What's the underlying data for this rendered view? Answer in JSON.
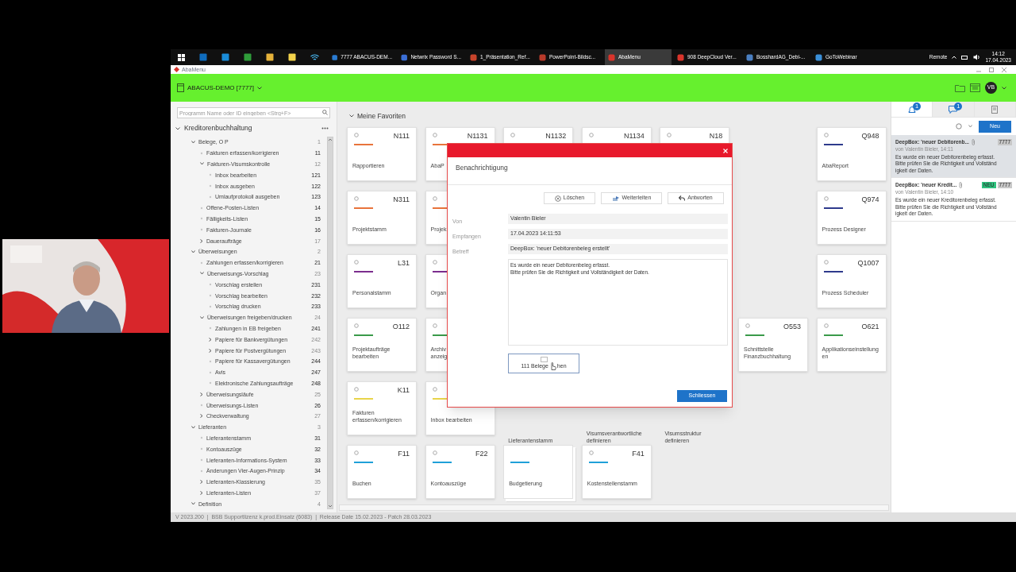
{
  "taskbar": {
    "apps": [
      {
        "label": "7777 ABACUS-DEM...",
        "color": "#2a7bd1",
        "selected": false
      },
      {
        "label": "Netwrix Password S...",
        "color": "#3b6fd6",
        "selected": false
      },
      {
        "label": "1_Präsentation_Ref...",
        "color": "#c8442b",
        "selected": false
      },
      {
        "label": "PowerPoint-Bildsc...",
        "color": "#b83a2a",
        "selected": false
      },
      {
        "label": "AbaMenu",
        "color": "#d9342b",
        "selected": true
      },
      {
        "label": "908 DeepCloud Ver...",
        "color": "#d9342b",
        "selected": false
      },
      {
        "label": "BosshardAG_Debi-...",
        "color": "#4a7fc1",
        "selected": false
      },
      {
        "label": "GoToWebinar",
        "color": "#3a8fd8",
        "selected": false
      }
    ],
    "remote": "Remote",
    "time": "14:12",
    "date": "17.04.2023"
  },
  "window": {
    "title": "AbaMenu"
  },
  "header": {
    "mandant": "ABACUS-DEMO [7777]",
    "user_initials": "VB"
  },
  "sidebar": {
    "search": {
      "placeholder": "Programm Name oder ID eingeben <Strg+F>"
    },
    "section": {
      "title": "Kreditorenbuchhaltung",
      "expanded": true
    },
    "tree": [
      {
        "label": "Belege, O P",
        "number": "1",
        "expanded": true,
        "children": [
          {
            "label": "Fakturen erfassen/korrigieren",
            "number": "11"
          },
          {
            "label": "Fakturen-Visumskontrolle",
            "number": "12",
            "expanded": true,
            "children": [
              {
                "label": "Inbox bearbeiten",
                "number": "121"
              },
              {
                "label": "Inbox ausgeben",
                "number": "122"
              },
              {
                "label": "Umlaufprotokoll ausgeben",
                "number": "123"
              }
            ]
          },
          {
            "label": "Offene-Posten-Listen",
            "number": "14"
          },
          {
            "label": "Fälligkeits-Listen",
            "number": "15"
          },
          {
            "label": "Fakturen-Journale",
            "number": "16"
          },
          {
            "label": "Daueraufträge",
            "number": "17",
            "expanded": false
          }
        ]
      },
      {
        "label": "Überweisungen",
        "number": "2",
        "expanded": true,
        "children": [
          {
            "label": "Zahlungen erfassen/korrigieren",
            "number": "21"
          },
          {
            "label": "Überweisungs-Vorschlag",
            "number": "23",
            "expanded": true,
            "children": [
              {
                "label": "Vorschlag erstellen",
                "number": "231"
              },
              {
                "label": "Vorschlag bearbeiten",
                "number": "232"
              },
              {
                "label": "Vorschlag drucken",
                "number": "233"
              }
            ]
          },
          {
            "label": "Überweisungen freigeben/drucken",
            "number": "24",
            "expanded": true,
            "children": [
              {
                "label": "Zahlungen in EB freigeben",
                "number": "241"
              },
              {
                "label": "Papiere für Bankvergütungen",
                "number": "242",
                "expanded": false
              },
              {
                "label": "Papiere für Postvergütungen",
                "number": "243",
                "expanded": false
              },
              {
                "label": "Papiere für Kassavergütungen",
                "number": "244"
              },
              {
                "label": "Avis",
                "number": "247"
              },
              {
                "label": "Elektronische Zahlungsaufträge",
                "number": "248"
              }
            ]
          },
          {
            "label": "Überweisungsläufe",
            "number": "25",
            "expanded": false
          },
          {
            "label": "Überweisungs-Listen",
            "number": "26"
          },
          {
            "label": "Checkverwaltung",
            "number": "27",
            "expanded": false
          }
        ]
      },
      {
        "label": "Lieferanten",
        "number": "3",
        "expanded": true,
        "children": [
          {
            "label": "Lieferantenstamm",
            "number": "31"
          },
          {
            "label": "Kontoauszüge",
            "number": "32"
          },
          {
            "label": "Lieferanten-Informations-System",
            "number": "33"
          },
          {
            "label": "Änderungen Vier-Augen-Prinzip",
            "number": "34"
          },
          {
            "label": "Lieferanten-Klassierung",
            "number": "35",
            "expanded": false
          },
          {
            "label": "Lieferanten-Listen",
            "number": "37",
            "expanded": false
          }
        ]
      },
      {
        "label": "Definition",
        "number": "4",
        "expanded": true
      }
    ]
  },
  "favorites": {
    "title": "Meine Favoriten",
    "expanded": true,
    "rows": [
      [
        {
          "kind": "card",
          "code": "N111",
          "color": "#e8743b",
          "label": "Rapportieren"
        },
        {
          "kind": "card",
          "code": "N1131",
          "color": "#e8743b",
          "label": "AbaP"
        },
        {
          "kind": "card",
          "code": "N1132"
        },
        {
          "kind": "card",
          "code": "N1134"
        },
        {
          "kind": "card",
          "code": "N18"
        },
        {
          "kind": "empty"
        },
        {
          "kind": "card",
          "code": "Q948",
          "color": "#2e3a8c",
          "label": "AbaReport"
        }
      ],
      [
        {
          "kind": "card",
          "code": "N311",
          "color": "#e8743b",
          "label": "Projektstamm"
        },
        {
          "kind": "card",
          "color": "#e8743b",
          "label": "Projek"
        },
        {
          "kind": "empty"
        },
        {
          "kind": "empty"
        },
        {
          "kind": "empty"
        },
        {
          "kind": "empty"
        },
        {
          "kind": "card",
          "code": "Q974",
          "color": "#2e3a8c",
          "label": "Prozess Designer"
        }
      ],
      [
        {
          "kind": "card",
          "code": "L31",
          "color": "#7b2d8e",
          "label": "Personalstamm"
        },
        {
          "kind": "card",
          "color": "#7b2d8e",
          "label": "Organ"
        },
        {
          "kind": "empty"
        },
        {
          "kind": "empty"
        },
        {
          "kind": "empty"
        },
        {
          "kind": "empty"
        },
        {
          "kind": "card",
          "code": "Q1007",
          "color": "#2e3a8c",
          "label": "Prozess Scheduler"
        }
      ],
      [
        {
          "kind": "card",
          "code": "O112",
          "color": "#3a9a4a",
          "label": "Projektaufträge\nbearbeiten"
        },
        {
          "kind": "card",
          "color": "#3a9a4a",
          "label": "Archiv\nanzeig"
        },
        {
          "kind": "empty"
        },
        {
          "kind": "empty"
        },
        {
          "kind": "empty"
        },
        {
          "kind": "card",
          "code": "O553",
          "color": "#3a9a4a",
          "label": "Schnittstelle\nFinanzbuchhaltung"
        },
        {
          "kind": "card",
          "code": "O621",
          "color": "#3a9a4a",
          "label": "Applikationseinstellung\nen"
        }
      ],
      [
        {
          "kind": "card",
          "code": "K11",
          "color": "#e8d44a",
          "label": "Fakturen\nerfassen/korrigieren"
        },
        {
          "kind": "card",
          "color": "#e8d44a",
          "label": "Inbox bearbeiten"
        },
        {
          "kind": "covered",
          "label": "Lieferantenstamm"
        },
        {
          "kind": "covered",
          "label": "Visumsverantwortliche\ndefinieren"
        },
        {
          "kind": "covered",
          "label": "Visumsstruktur\ndefinieren"
        },
        {
          "kind": "empty"
        },
        {
          "kind": "empty"
        }
      ],
      [
        {
          "kind": "card",
          "code": "F11",
          "color": "#1fa0d8",
          "label": "Buchen"
        },
        {
          "kind": "card",
          "code": "F22",
          "color": "#1fa0d8",
          "label": "Kontoauszüge"
        },
        {
          "kind": "stack",
          "color": "#1fa0d8",
          "label": "Budgetierung"
        },
        {
          "kind": "card",
          "code": "F41",
          "color": "#1fa0d8",
          "label": "Kostenstellenstamm"
        },
        {
          "kind": "empty"
        },
        {
          "kind": "empty"
        },
        {
          "kind": "empty"
        }
      ]
    ]
  },
  "dialog": {
    "title": "Benachrichtigung",
    "actions": [
      {
        "kind": "delete",
        "label": "Löschen"
      },
      {
        "kind": "forward",
        "label": "Weiterleiten"
      },
      {
        "kind": "reply",
        "label": "Antworten"
      }
    ],
    "fields": [
      {
        "label": "Von",
        "value": "Valentin Bieler"
      },
      {
        "label": "Empfangen",
        "value": "17.04.2023 14:11:53"
      },
      {
        "label": "Betreff",
        "value": "DeepBox: 'neuer Debitorenbeleg erstellt'"
      }
    ],
    "message": [
      "Es wurde ein neuer Debitorenbeleg erfasst.",
      "Bitte prüfen Sie die Richtigkeit und Vollständigkeit der Daten."
    ],
    "attachment_button": {
      "text_before_cursor": "111 Belege",
      "text_after_cursor": "hen"
    },
    "close_button": "Schliessen"
  },
  "notifications": {
    "tabs": [
      {
        "kind": "bell",
        "badge": "1",
        "selected": true
      },
      {
        "kind": "chat",
        "badge": "1",
        "selected": false
      },
      {
        "kind": "document",
        "selected": false
      }
    ],
    "new_button": "Neu",
    "messages": [
      {
        "title": "DeepBox: 'neuer Debitorenb...",
        "meta": "von Valentin Bieler, 14:11",
        "tags": [
          {
            "label": "7777",
            "color": "#c8c8c8"
          }
        ],
        "body": [
          "Es wurde ein neuer Debitorenbeleg erfasst.",
          "Bitte prüfen Sie die Richtigkeit und Vollständ",
          "igkeit der Daten."
        ],
        "selected": true
      },
      {
        "title": "DeepBox: 'neuer Kredit...",
        "meta": "von Valentin Bieler, 14:10",
        "tags": [
          {
            "label": "NEU",
            "color": "#2ec27e"
          },
          {
            "label": "7777",
            "color": "#c8c8c8"
          }
        ],
        "body": [
          "Es wurde ein neuer Kreditorenbeleg erfasst.",
          "Bitte prüfen Sie die Richtigkeit und Vollständ",
          "igkeit der Daten."
        ],
        "selected": false
      }
    ]
  },
  "status_bar": "V 2023.200  |  BSB Supportlizenz k.prod.Einsatz (6083)  |  Release Date 15.02.2023 - Patch 28.03.2023"
}
